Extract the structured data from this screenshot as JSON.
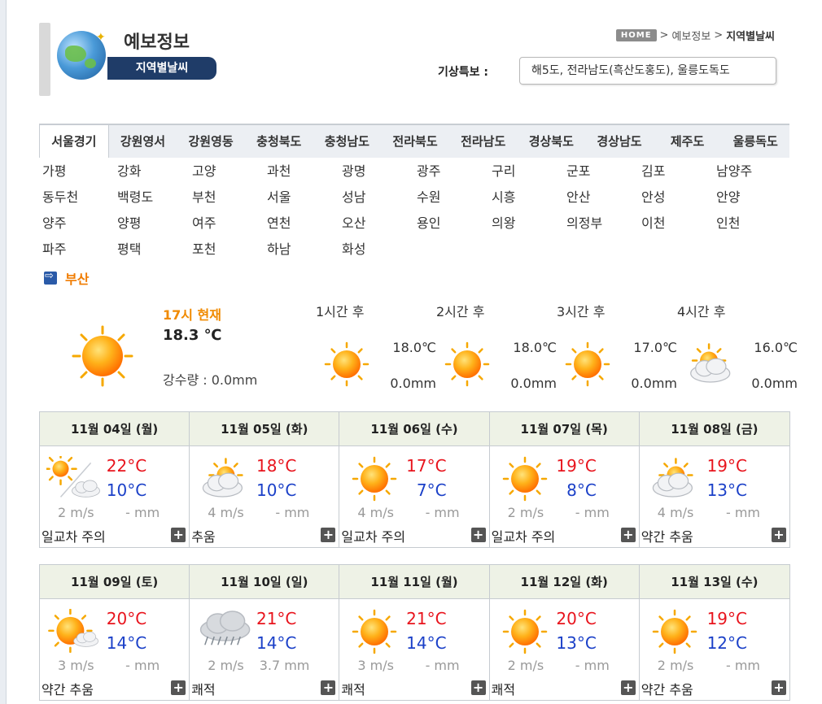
{
  "header": {
    "title": "예보정보",
    "subtitle": "지역별날씨",
    "breadcrumb": {
      "home": "HOME",
      "level1": "예보정보",
      "current": "지역별날씨"
    },
    "alert_label": "기상특보 :",
    "alert_text": "해5도, 전라남도(흑산도홍도), 울릉도독도"
  },
  "regions": [
    "서울경기",
    "강원영서",
    "강원영동",
    "충청북도",
    "충청남도",
    "전라북도",
    "전라남도",
    "경상북도",
    "경상남도",
    "제주도",
    "울릉독도"
  ],
  "active_region": "서울경기",
  "cities": [
    "가평",
    "강화",
    "고양",
    "과천",
    "광명",
    "광주",
    "구리",
    "군포",
    "김포",
    "남양주",
    "동두천",
    "백령도",
    "부천",
    "서울",
    "성남",
    "수원",
    "시흥",
    "안산",
    "안성",
    "안양",
    "양주",
    "양평",
    "여주",
    "연천",
    "오산",
    "용인",
    "의왕",
    "의정부",
    "이천",
    "인천",
    "파주",
    "평택",
    "포천",
    "하남",
    "화성"
  ],
  "selected_city": "부산",
  "current": {
    "time": "17시 현재",
    "temp": "18.3 ℃",
    "rain": "강수량 : 0.0mm",
    "icon": "sun-icon"
  },
  "hourly": [
    {
      "label": "1시간 후",
      "temp": "18.0℃",
      "rain": "0.0mm",
      "icon": "sun-icon"
    },
    {
      "label": "2시간 후",
      "temp": "18.0℃",
      "rain": "0.0mm",
      "icon": "sun-icon"
    },
    {
      "label": "3시간 후",
      "temp": "17.0℃",
      "rain": "0.0mm",
      "icon": "sun-icon"
    },
    {
      "label": "4시간 후",
      "temp": "16.0℃",
      "rain": "0.0mm",
      "icon": "partly-cloudy-icon"
    }
  ],
  "week1": [
    {
      "date": "11월 04일 (월)",
      "max": "22°C",
      "min": "10°C",
      "wind": "2 m/s",
      "rain": "- mm",
      "note": "일교차 주의",
      "icon": "sun-then-cloud-icon"
    },
    {
      "date": "11월 05일 (화)",
      "max": "18°C",
      "min": "10°C",
      "wind": "4 m/s",
      "rain": "- mm",
      "note": "추움",
      "icon": "partly-cloudy-icon"
    },
    {
      "date": "11월 06일 (수)",
      "max": "17°C",
      "min": "7°C",
      "wind": "4 m/s",
      "rain": "- mm",
      "note": "일교차 주의",
      "icon": "sun-icon"
    },
    {
      "date": "11월 07일 (목)",
      "max": "19°C",
      "min": "8°C",
      "wind": "2 m/s",
      "rain": "- mm",
      "note": "일교차 주의",
      "icon": "sun-icon"
    },
    {
      "date": "11월 08일 (금)",
      "max": "19°C",
      "min": "13°C",
      "wind": "4 m/s",
      "rain": "- mm",
      "note": "약간 추움",
      "icon": "partly-cloudy-icon"
    }
  ],
  "week2": [
    {
      "date": "11월 09일 (토)",
      "max": "20°C",
      "min": "14°C",
      "wind": "3 m/s",
      "rain": "- mm",
      "note": "약간 추움",
      "icon": "sun-small-cloud-icon"
    },
    {
      "date": "11월 10일 (일)",
      "max": "21°C",
      "min": "14°C",
      "wind": "2 m/s",
      "rain": "3.7 mm",
      "note": "쾌적",
      "icon": "rain-cloud-icon"
    },
    {
      "date": "11월 11일 (월)",
      "max": "21°C",
      "min": "14°C",
      "wind": "3 m/s",
      "rain": "- mm",
      "note": "쾌적",
      "icon": "sun-icon"
    },
    {
      "date": "11월 12일 (화)",
      "max": "20°C",
      "min": "13°C",
      "wind": "2 m/s",
      "rain": "- mm",
      "note": "쾌적",
      "icon": "sun-icon"
    },
    {
      "date": "11월 13일 (수)",
      "max": "19°C",
      "min": "12°C",
      "wind": "2 m/s",
      "rain": "- mm",
      "note": "약간 추움",
      "icon": "sun-icon"
    }
  ],
  "plus_label": "+",
  "colors": {
    "max_temp": "#e8141d",
    "min_temp": "#1b40c8",
    "accent": "#f07c00",
    "header_bar": "#1f3c68"
  }
}
